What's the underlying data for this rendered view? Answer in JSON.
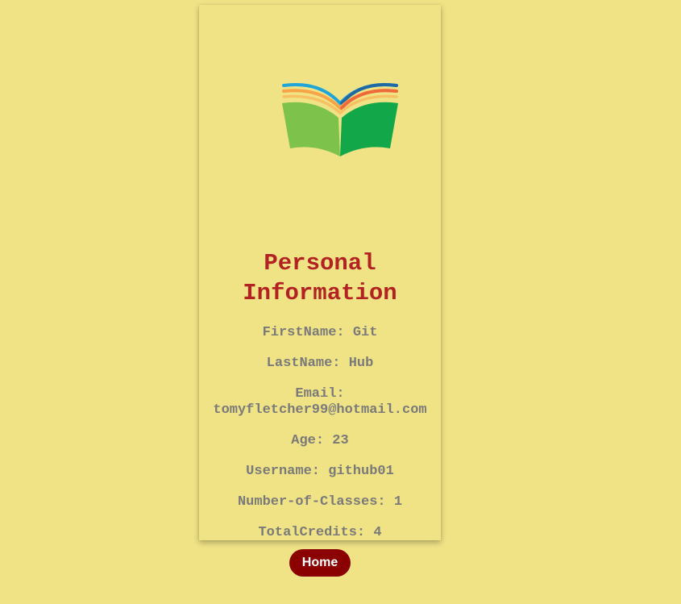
{
  "profile": {
    "title": "Personal Information",
    "fields": [
      {
        "label": "FirstName:",
        "value": "Git"
      },
      {
        "label": "LastName:",
        "value": "Hub"
      },
      {
        "label": "Email:",
        "value": "tomyfletcher99@hotmail.com"
      },
      {
        "label": "Age:",
        "value": "23"
      },
      {
        "label": "Username:",
        "value": "github01"
      },
      {
        "label": "Number-of-Classes:",
        "value": "1"
      },
      {
        "label": "TotalCredits:",
        "value": "4"
      }
    ]
  },
  "nav": {
    "home_label": "Home"
  },
  "logo": {
    "icon": "open-book-icon",
    "colors": {
      "left_page": "#7dc24b",
      "right_page": "#12a84a",
      "arc_blue": "#1fa5d8",
      "arc_dark_blue": "#1f6aa5",
      "arc_orange": "#f7a446",
      "arc_red": "#ef6a3a"
    }
  },
  "colors": {
    "background": "#f0e386",
    "title": "#b22222",
    "text": "#7a7a7a",
    "button": "#8b0000"
  }
}
